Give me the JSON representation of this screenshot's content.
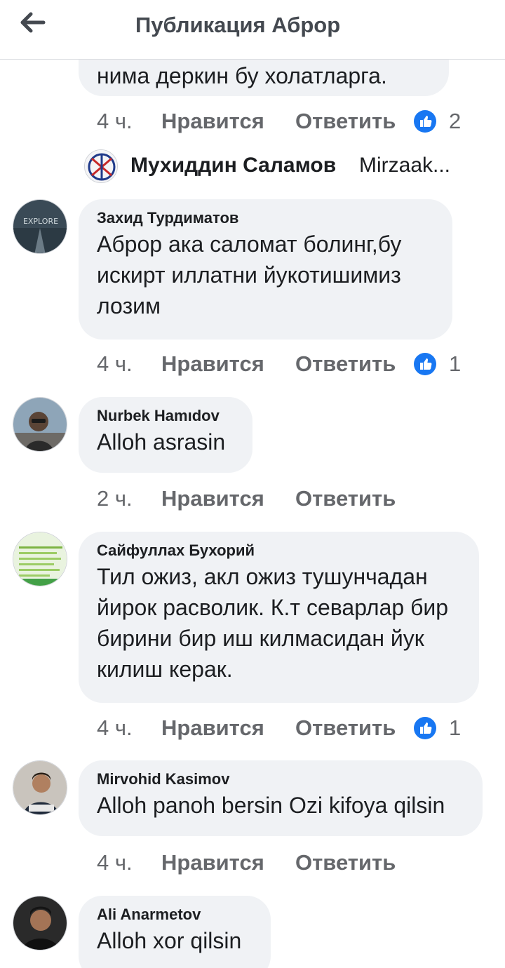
{
  "header": {
    "title": "Публикация Аброр",
    "back_icon": "arrow-left-icon"
  },
  "colors": {
    "like_blue": "#1877f2",
    "meta_gray": "#65676b",
    "bubble_bg": "#f0f2f5"
  },
  "top_fragment": {
    "text": "нима деркин бу холатларга.",
    "time": "4 ч.",
    "like": "Нравится",
    "reply": "Ответить",
    "reactions": "2"
  },
  "reply_preview": {
    "name": "Мухиддин Саламов",
    "text": "Mirzaak..."
  },
  "comments": [
    {
      "name": "Захид Турдиматов",
      "text": "Аброр ака саломат болинг,бу искирт иллатни йукотишимиз лозим",
      "time": "4 ч.",
      "like": "Нравится",
      "reply": "Ответить",
      "reactions": "1"
    },
    {
      "name": "Nurbek Hamıdov",
      "text": "Alloh asrasin",
      "time": "2 ч.",
      "like": "Нравится",
      "reply": "Ответить"
    },
    {
      "name": "Сайфуллах Бухорий",
      "text": "Тил ожиз, акл ожиз  тушунчадан йирок расволик. К.т севарлар бир бирини бир иш килмасидан йук килиш керак.",
      "time": "4 ч.",
      "like": "Нравится",
      "reply": "Ответить",
      "reactions": "1"
    },
    {
      "name": "Mirvohid Kasimov",
      "text": "Alloh panoh bersin Ozi kifoya qilsin",
      "time": "4 ч.",
      "like": "Нравится",
      "reply": "Ответить"
    },
    {
      "name": "Ali Anarmetov",
      "text": "Alloh xor qilsin"
    }
  ]
}
